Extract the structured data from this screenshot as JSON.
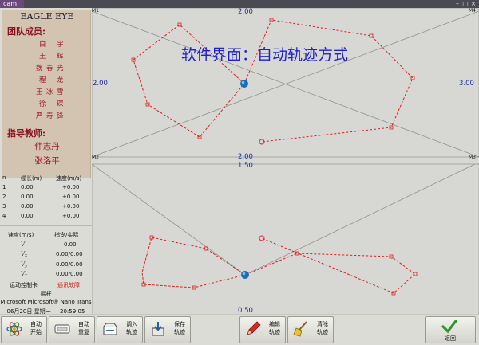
{
  "window": {
    "title": "cam"
  },
  "team": {
    "title": "EAGLE EYE",
    "members_heading": "团队成员:",
    "members": [
      [
        "白",
        "宇"
      ],
      [
        "王",
        "辉"
      ],
      [
        "魏",
        "春",
        "光"
      ],
      [
        "程",
        "龙"
      ],
      [
        "王",
        "冰",
        "雪"
      ],
      [
        "徐",
        "琛"
      ],
      [
        "严",
        "寿",
        "锋"
      ]
    ],
    "teachers_heading": "指导教师:",
    "teachers": [
      "仲志丹",
      "张洛平"
    ]
  },
  "cable_table": {
    "headers": [
      "n",
      "缆长(m)",
      "速度(m/s)"
    ],
    "rows": [
      [
        "1",
        "0.00",
        "+0.00"
      ],
      [
        "2",
        "0.00",
        "+0.00"
      ],
      [
        "3",
        "0.00",
        "+0.00"
      ],
      [
        "4",
        "0.00",
        "+0.00"
      ]
    ]
  },
  "velocity_table": {
    "headers": [
      "速度(m/s)",
      "指令/实际"
    ],
    "rows": [
      {
        "label": "V",
        "sub": "",
        "value": "0.00"
      },
      {
        "label": "V",
        "sub": "x",
        "value": "0.00/0.00"
      },
      {
        "label": "V",
        "sub": "y",
        "value": "0.00/0.00"
      },
      {
        "label": "V",
        "sub": "z",
        "value": "0.00/0.00"
      }
    ]
  },
  "status": {
    "motion_card_label": "运动控制卡",
    "motion_card_value": "通讯故障",
    "joystick_label": "摇杆",
    "joystick_device": "Microsoft Microsoft® Nano Trans",
    "datetime": "06月20日 星期一 — 20:59:05"
  },
  "plot_top": {
    "label_top": "2.00",
    "label_bottom": "2.00",
    "label_left": "2.00",
    "label_right": "3.00",
    "corners": [
      "M1",
      "M4",
      "M2",
      "M3"
    ],
    "overlay_text": "软件界面：自动轨迹方式"
  },
  "plot_bottom": {
    "label_top": "1.50",
    "label_bottom": "0.50"
  },
  "colors": {
    "path": "#e02020",
    "label": "#1b2ea8",
    "overlay": "#2020d8",
    "fault": "#d42020",
    "team_bg": "#d3c4b2"
  },
  "toolbar": [
    {
      "id": "auto-start",
      "label": "自动\n开始",
      "icon": "atom-icon"
    },
    {
      "id": "auto-repeat",
      "label": "自动\n重复",
      "icon": "repeat-icon"
    },
    {
      "id": "load-track",
      "label": "调入\n轨迹",
      "icon": "load-icon"
    },
    {
      "id": "save-track",
      "label": "保存\n轨迹",
      "icon": "save-icon"
    },
    {
      "id": "edit-track",
      "label": "编辑\n轨迹",
      "icon": "pencil-icon"
    },
    {
      "id": "clear-track",
      "label": "清除\n轨迹",
      "icon": "broom-icon"
    },
    {
      "id": "back",
      "label": "返回",
      "icon": "check-icon"
    }
  ]
}
